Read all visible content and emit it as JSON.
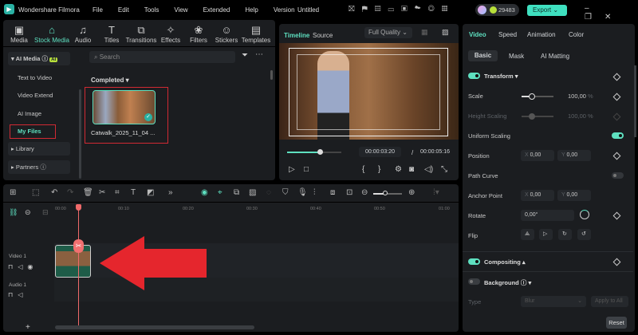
{
  "titlebar": {
    "app": "Wondershare Filmora",
    "menu": [
      "File",
      "Edit",
      "Tools",
      "View",
      "Extended",
      "Help",
      "Version"
    ],
    "project": "Untitled",
    "credits": "29483",
    "export": "Export"
  },
  "tabs": [
    {
      "label": "Media",
      "icon": "▣"
    },
    {
      "label": "Stock Media",
      "icon": "⌂"
    },
    {
      "label": "Audio",
      "icon": "♫"
    },
    {
      "label": "Titles",
      "icon": "T"
    },
    {
      "label": "Transitions",
      "icon": "⧉"
    },
    {
      "label": "Effects",
      "icon": "✧"
    },
    {
      "label": "Filters",
      "icon": "❀"
    },
    {
      "label": "Stickers",
      "icon": "☺"
    },
    {
      "label": "Templates",
      "icon": "▤"
    }
  ],
  "sidebar": {
    "ai_media": "AI Media",
    "ai_badge": "AI",
    "items": [
      "Text to Video",
      "Video Extend",
      "AI Image",
      "My Files"
    ],
    "library": "Library",
    "partners": "Partners"
  },
  "media": {
    "search_placeholder": "Search",
    "section": "Completed",
    "file_name": "Catwalk_2025_11_04 ..."
  },
  "preview": {
    "tab_timeline": "Timeline",
    "tab_source": "Source",
    "quality": "Full Quality",
    "current_time": "00:00:03:20",
    "separator": "/",
    "total_time": "00:00:05:16",
    "progress": 0.6
  },
  "props": {
    "tabs": [
      "Video",
      "Speed",
      "Animation",
      "Color"
    ],
    "subtabs": [
      "Basic",
      "Mask",
      "AI Matting"
    ],
    "transform": "Transform",
    "scale_label": "Scale",
    "scale_value": "100,00",
    "unit": "%",
    "height_label": "Height Scaling",
    "height_value": "100,00",
    "uniform": "Uniform Scaling",
    "position": "Position",
    "x_label": "X",
    "y_label": "Y",
    "pos_x": "0,00",
    "pos_y": "0,00",
    "path_curve": "Path Curve",
    "anchor": "Anchor Point",
    "anchor_x": "0,00",
    "anchor_y": "0,00",
    "rotate": "Rotate",
    "rotate_value": "0,00°",
    "flip": "Flip",
    "compositing": "Compositing",
    "background": "Background",
    "type_label": "Type",
    "type_value": "Blur",
    "apply_all": "Apply to All",
    "reset": "Reset"
  },
  "timeline": {
    "ticks": [
      "00:00",
      "00:10",
      "00:20",
      "00:30",
      "00:40",
      "00:50",
      "01:00"
    ],
    "video_track": "Video 1",
    "audio_track": "Audio 1",
    "add": "+"
  }
}
